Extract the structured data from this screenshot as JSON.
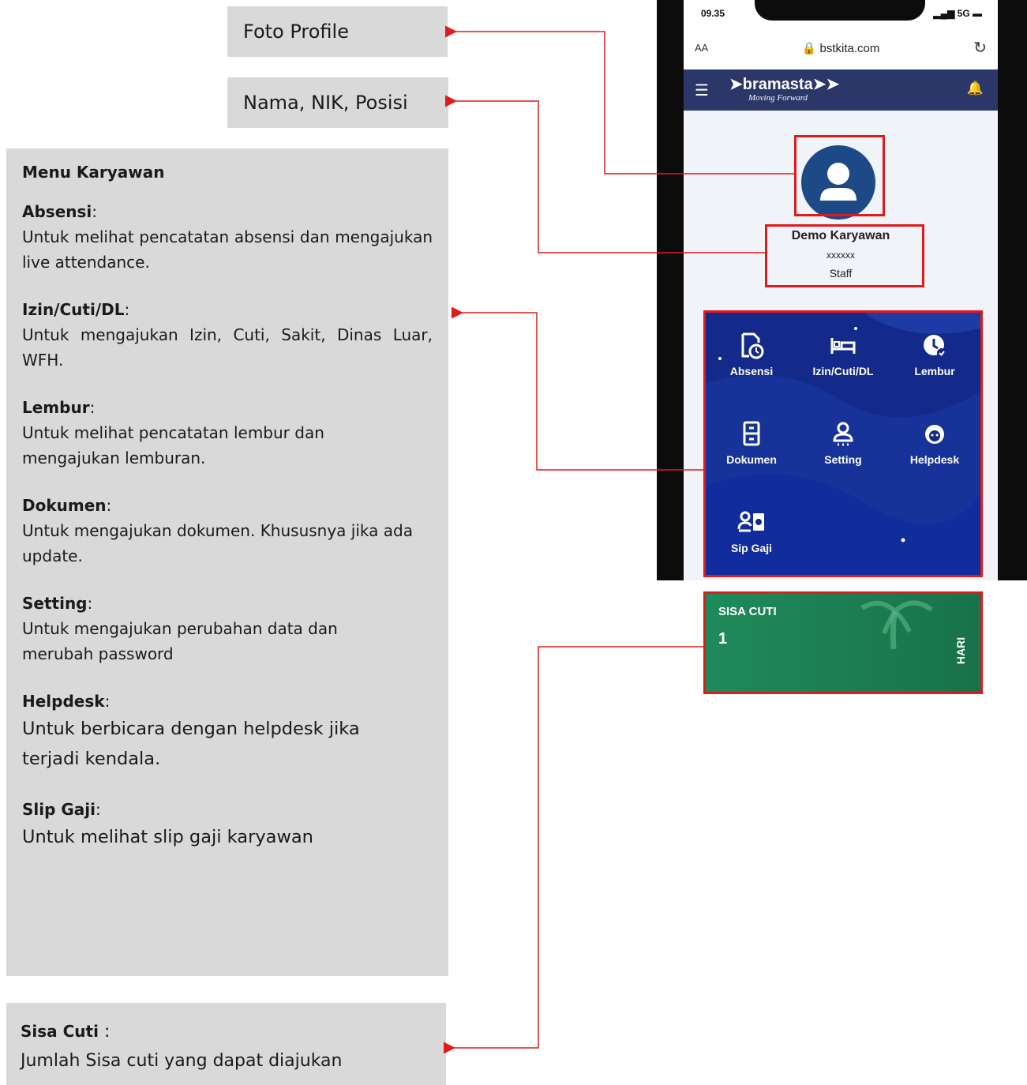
{
  "callouts": {
    "foto": "Foto Profile",
    "nama": "Nama, NIK, Posisi",
    "menu": {
      "heading": "Menu Karyawan",
      "items": [
        {
          "title": "Absensi",
          "desc": "Untuk melihat pencatatan absensi dan mengajukan live attendance."
        },
        {
          "title": "Izin/Cuti/DL",
          "desc": "Untuk mengajukan Izin, Cuti, Sakit, Dinas Luar, WFH."
        },
        {
          "title": "Lembur",
          "desc": "Untuk melihat pencatatan lembur dan mengajukan lemburan."
        },
        {
          "title": "Dokumen",
          "desc": "Untuk mengajukan dokumen. Khususnya jika ada update."
        },
        {
          "title": "Setting",
          "desc": "Untuk mengajukan perubahan data dan merubah password"
        },
        {
          "title": "Helpdesk",
          "desc": "Untuk berbicara dengan helpdesk jika terjadi kendala."
        },
        {
          "title": "Slip Gaji",
          "desc": "Untuk melihat slip gaji karyawan"
        }
      ]
    },
    "sisa": {
      "title": "Sisa Cuti",
      "desc": "Jumlah Sisa cuti yang dapat diajukan"
    }
  },
  "phone": {
    "time": "09.35",
    "signal": "5G",
    "url_aa": "AA",
    "url": "bstkita.com",
    "brand": "bramasta",
    "tagline": "Moving Forward",
    "profile": {
      "name": "Demo Karyawan",
      "nik": "xxxxxx",
      "position": "Staff"
    },
    "menu": [
      {
        "label": "Absensi",
        "icon": "absensi-icon"
      },
      {
        "label": "Izin/Cuti/DL",
        "icon": "bed-icon"
      },
      {
        "label": "Lembur",
        "icon": "clock-check-icon"
      },
      {
        "label": "Dokumen",
        "icon": "document-icon"
      },
      {
        "label": "Setting",
        "icon": "user-setting-icon"
      },
      {
        "label": "Helpdesk",
        "icon": "headset-icon"
      },
      {
        "label": "Sip Gaji",
        "icon": "payslip-icon"
      }
    ],
    "cuti": {
      "label": "SISA CUTI",
      "value": "1",
      "unit": "HARI"
    }
  },
  "colors": {
    "annotation_red": "#e01b1b",
    "callout_gray": "#d9d9d9",
    "appbar": "#2b3768",
    "menu_blue": "#142a8a",
    "cuti_green": "#1f8a5a"
  }
}
